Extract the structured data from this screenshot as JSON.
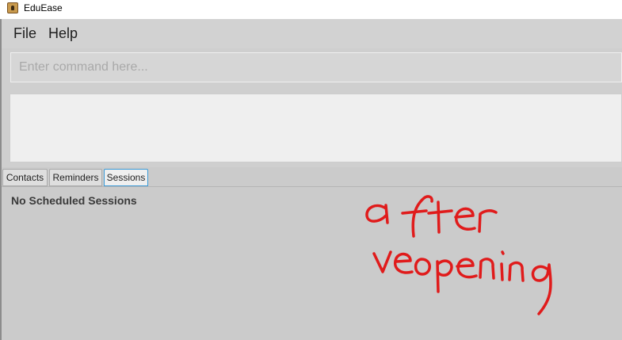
{
  "window": {
    "title": "EduEase"
  },
  "menu": {
    "items": [
      "File",
      "Help"
    ]
  },
  "command": {
    "placeholder": "Enter command here...",
    "value": ""
  },
  "tabs": {
    "items": [
      "Contacts",
      "Reminders",
      "Sessions"
    ],
    "active": "Sessions"
  },
  "content": {
    "message": "No Scheduled Sessions"
  },
  "annotation": {
    "text": "after reopening",
    "color": "#e01b1b"
  },
  "colors": {
    "active_tab_border": "#3b9ad6",
    "background": "#cbcbcb"
  }
}
